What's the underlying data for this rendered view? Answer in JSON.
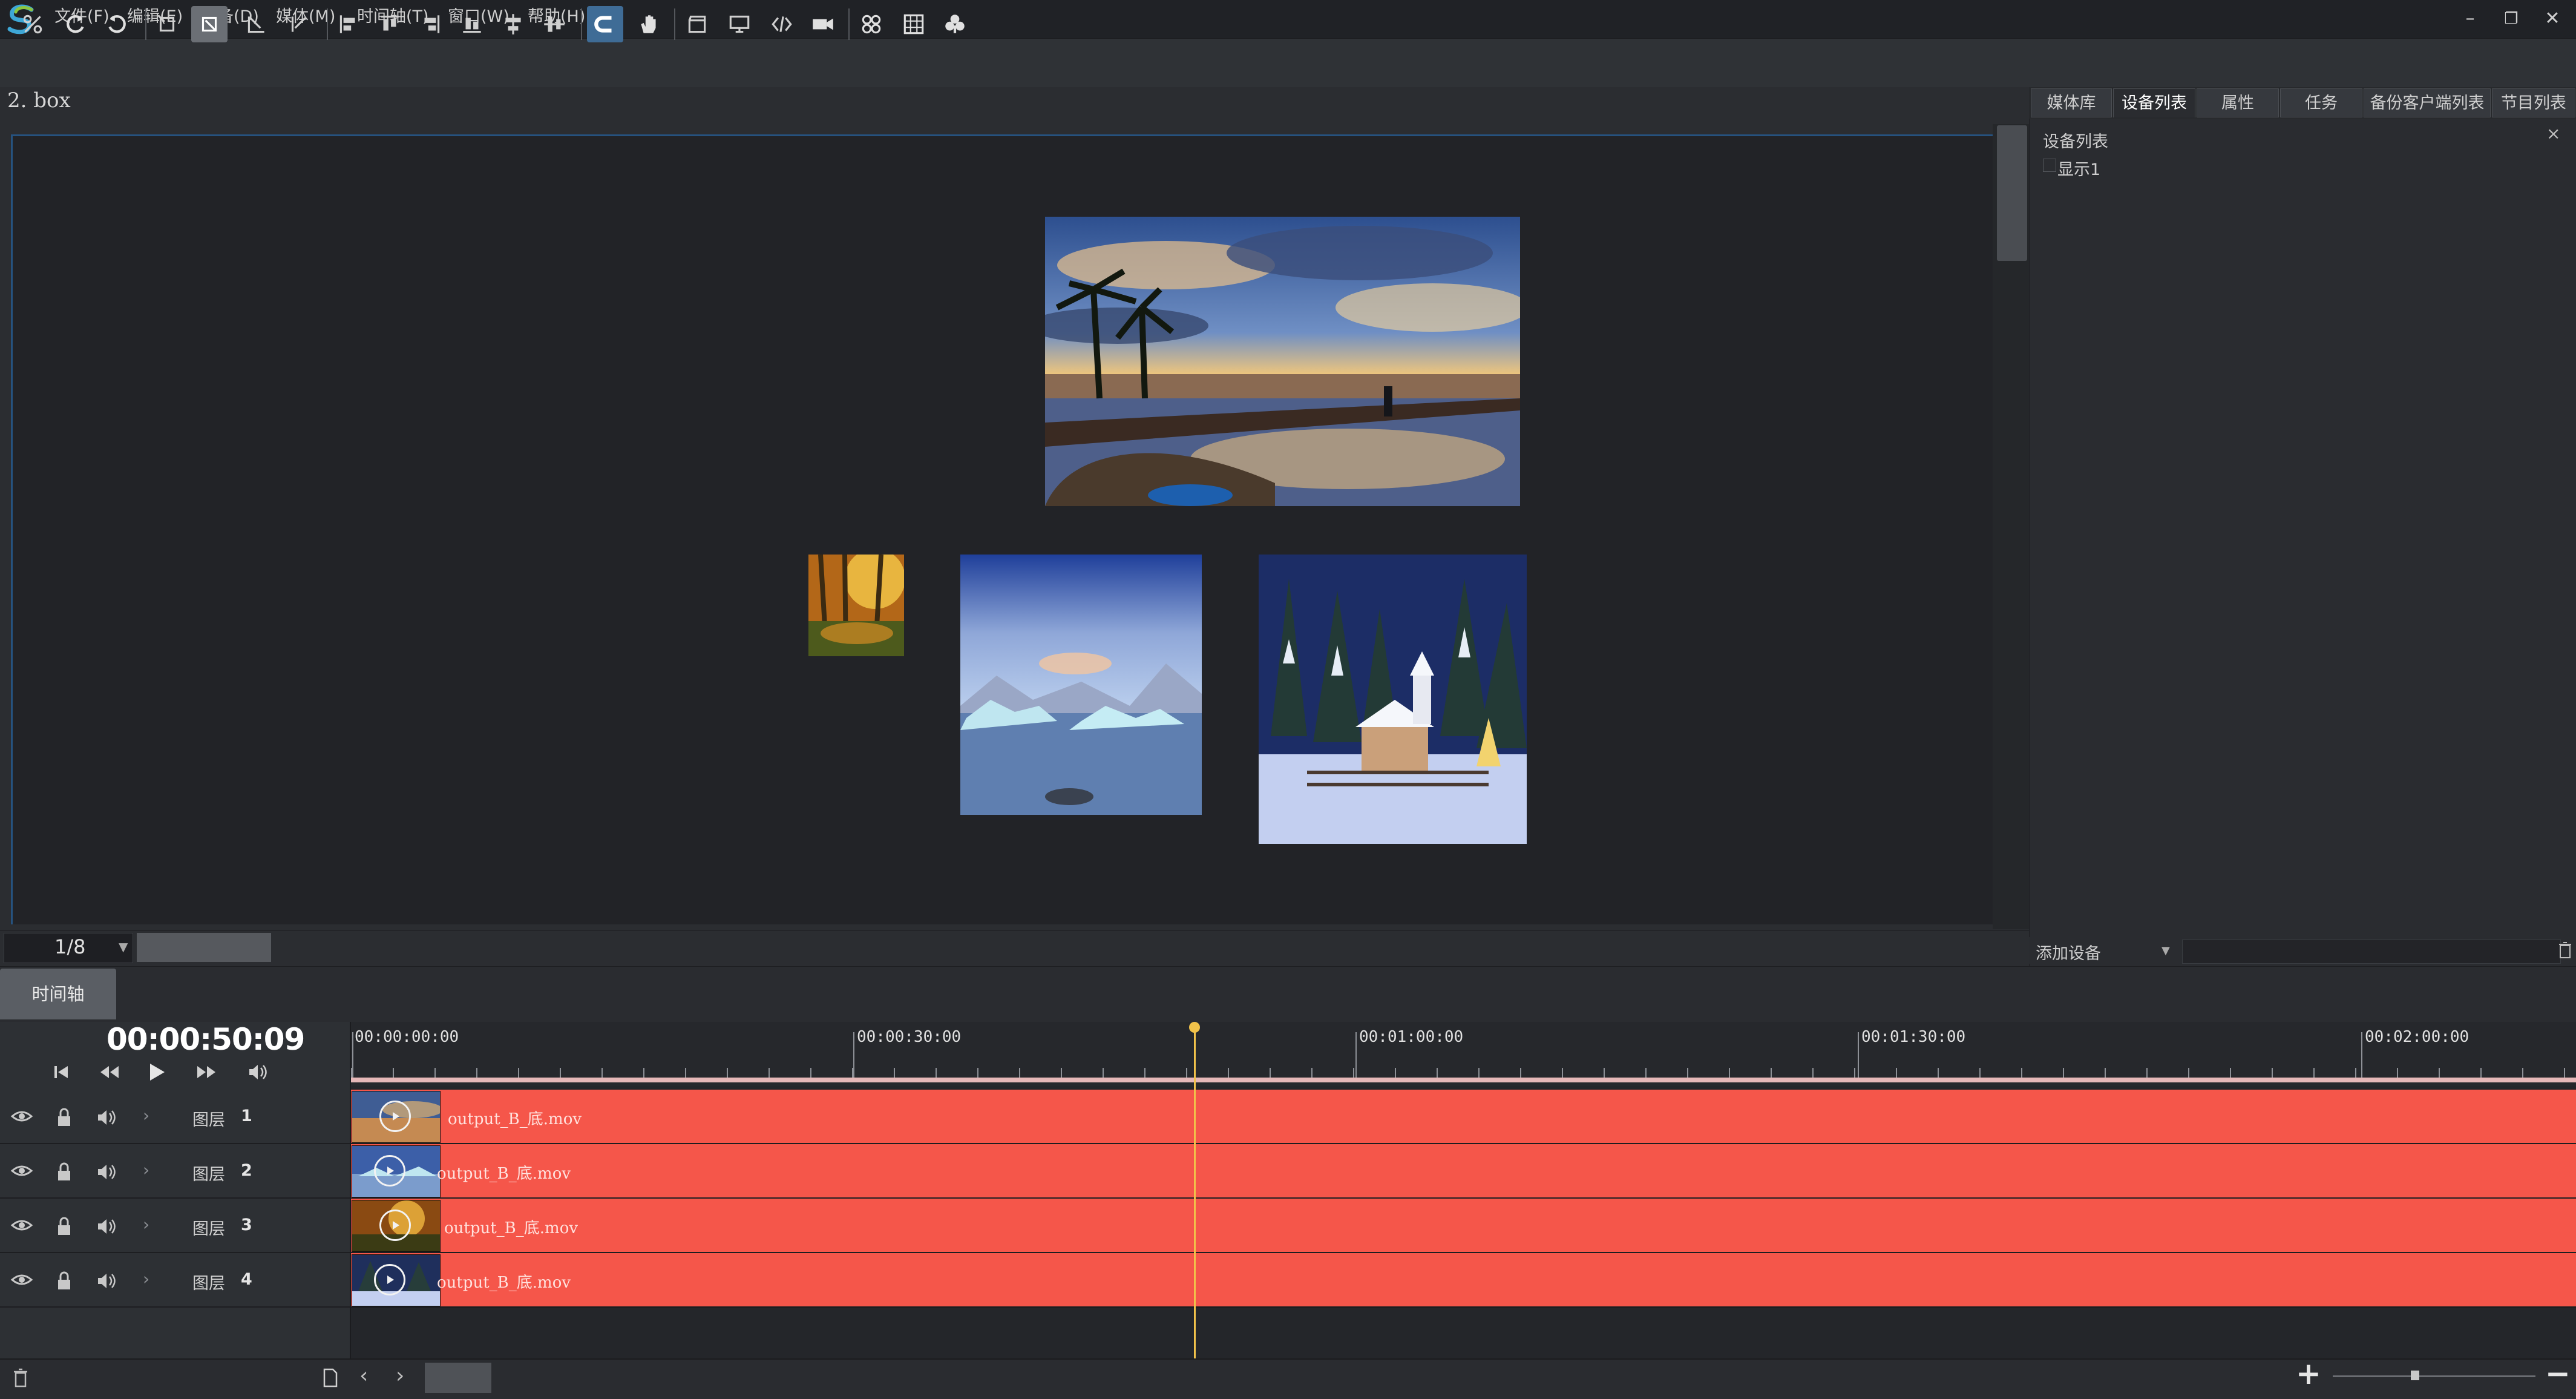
{
  "menu": [
    "文件(F)",
    "编辑(E)",
    "设备(D)",
    "媒体(M)",
    "时间轴(T)",
    "窗口(W)",
    "帮助(H)"
  ],
  "window_controls": {
    "minimize": "–",
    "restore": "❐",
    "close": "✕"
  },
  "toolbar": {
    "icons": [
      "group-icon",
      "rotate-left-icon",
      "rotate-right-icon",
      "select-icon",
      "select-active-icon",
      "top-left-icon",
      "top-right-icon",
      "align-left-icon",
      "align-top-icon",
      "align-right-icon",
      "align-bottom-icon",
      "distribute-h-icon",
      "distribute-v-icon",
      "magnet-icon",
      "hand-icon",
      "clapper-icon",
      "monitor-icon",
      "code-icon",
      "camera-icon",
      "grid-small-icon",
      "grid-icon",
      "club-icon"
    ],
    "active": [
      "magnet-icon"
    ]
  },
  "canvas": {
    "title": "2. box",
    "page": "1/8"
  },
  "right_panel": {
    "tabs": [
      "媒体库",
      "设备列表",
      "属性",
      "任务",
      "备份客户端列表",
      "节目列表"
    ],
    "active_tab": "设备列表",
    "close": "×",
    "device_list_title": "设备列表",
    "devices": [
      "显示1"
    ],
    "add_device": "添加设备"
  },
  "timeline": {
    "tab": "时间轴",
    "timecode": "00:00:50:09",
    "ruler_labels": [
      "00:00:00:00",
      "00:00:30:00",
      "00:01:00:00",
      "00:01:30:00",
      "00:02:00:00"
    ],
    "layers": [
      {
        "label": "图层",
        "num": "1",
        "clip": "output_B_底.mov"
      },
      {
        "label": "图层",
        "num": "2",
        "clip": "output_B_底.mov"
      },
      {
        "label": "图层",
        "num": "3",
        "clip": "output_B_底.mov"
      },
      {
        "label": "图层",
        "num": "4",
        "clip": "output_B_底.mov"
      }
    ]
  },
  "colors": {
    "track": "#f5564a",
    "playhead": "#f1c24a",
    "accent": "#3f6c96"
  }
}
